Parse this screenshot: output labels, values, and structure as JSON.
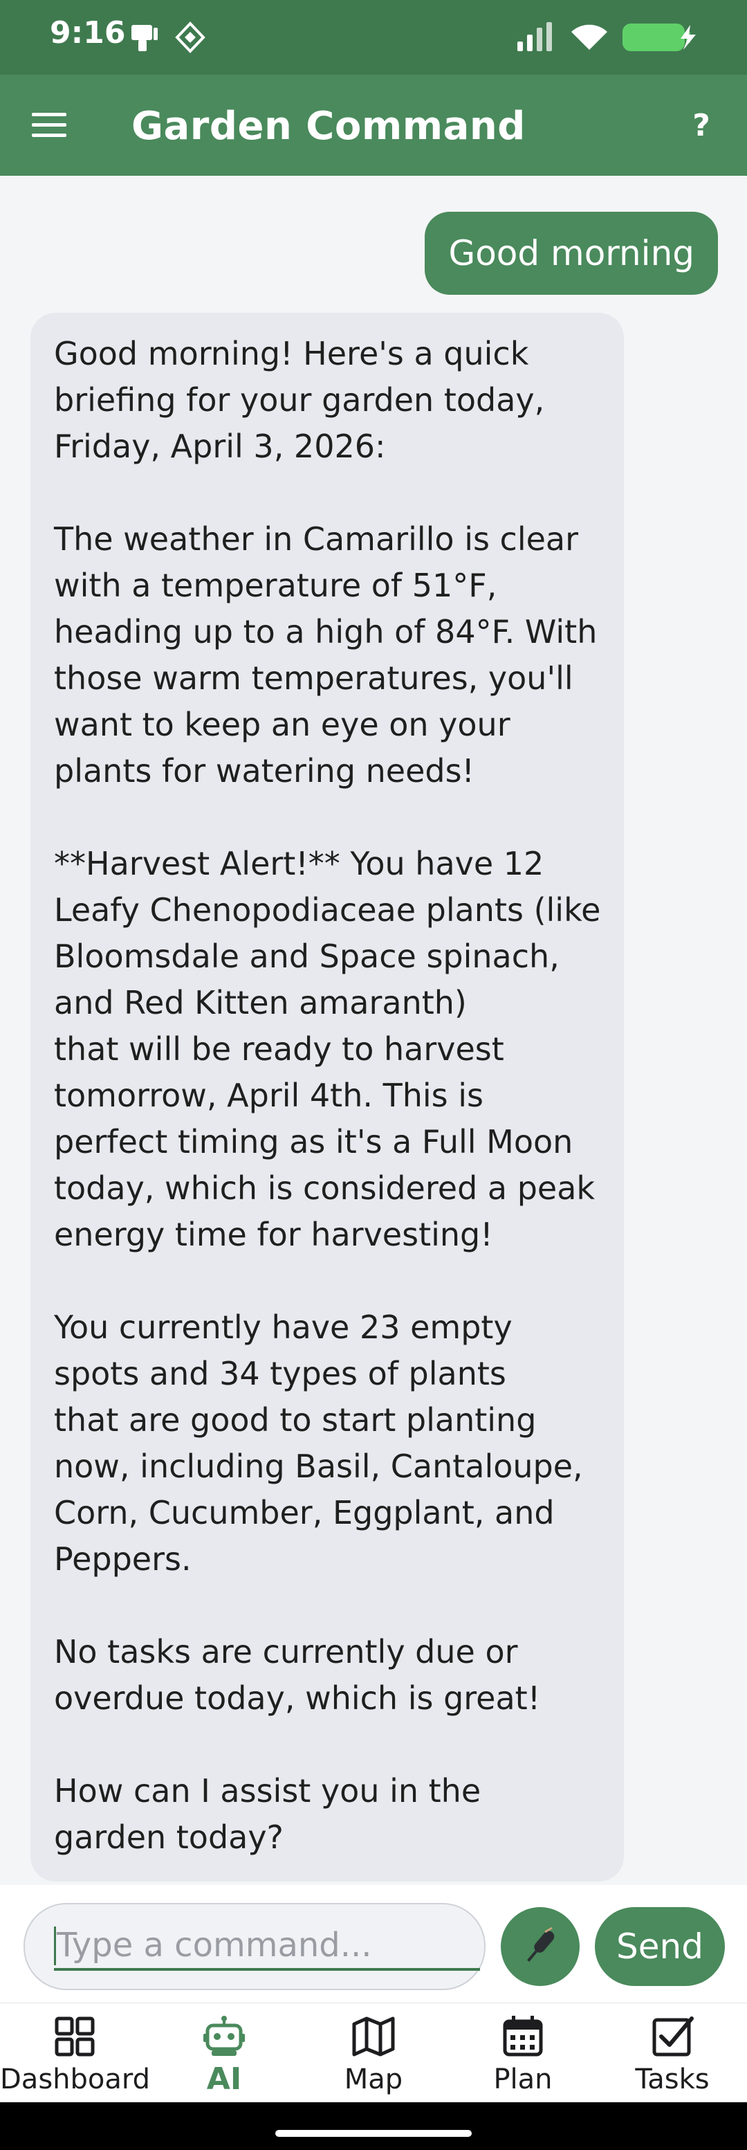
{
  "status_bar": {
    "time": "9:16",
    "icons": [
      "phone-cast-icon",
      "diamond-notification-icon",
      "signal-icon",
      "wifi-icon",
      "battery-charging-icon"
    ],
    "battery_color": "#5fd068"
  },
  "app_bar": {
    "title": "Garden Command",
    "help_label": "?",
    "menu_icon": "hamburger-menu-icon"
  },
  "chat": {
    "user_message": "Good morning",
    "ai_paragraphs": [
      "Good morning! Here's a quick\nbriefing for your garden today,\nFriday, April 3, 2026:",
      "The weather in Camarillo is clear\nwith a temperature of 51°F,\nheading up to a high of 84°F. With\nthose warm temperatures, you'll\nwant to keep an eye on your\nplants for watering needs!",
      "**Harvest Alert!** You have 12\nLeafy Chenopodiaceae plants (like\nBloomsdale and Space spinach,\nand Red Kitten amaranth)\nthat will be ready to harvest\ntomorrow, April 4th. This is\nperfect timing as it's a Full Moon\ntoday, which is considered a peak\nenergy time for harvesting!",
      "You currently have 23 empty\nspots and 34 types of plants\nthat are good to start planting\nnow, including Basil, Cantaloupe,\nCorn, Cucumber, Eggplant, and\nPeppers.",
      "No tasks are currently due or\noverdue today, which is great!",
      "How can I assist you in the\ngarden today?"
    ]
  },
  "input": {
    "placeholder": "Type a command...",
    "mic_icon": "microphone-icon",
    "send_label": "Send"
  },
  "nav": {
    "items": [
      {
        "label": "Dashboard",
        "icon": "grid-icon",
        "active": false
      },
      {
        "label": "AI",
        "icon": "robot-icon",
        "active": true
      },
      {
        "label": "Map",
        "icon": "map-icon",
        "active": false
      },
      {
        "label": "Plan",
        "icon": "calendar-icon",
        "active": false
      },
      {
        "label": "Tasks",
        "icon": "checkbox-icon",
        "active": false
      }
    ]
  },
  "colors": {
    "brand_green": "#4a8a5c",
    "status_green": "#3f7a4f",
    "ai_bubble": "#e8e9ee"
  }
}
